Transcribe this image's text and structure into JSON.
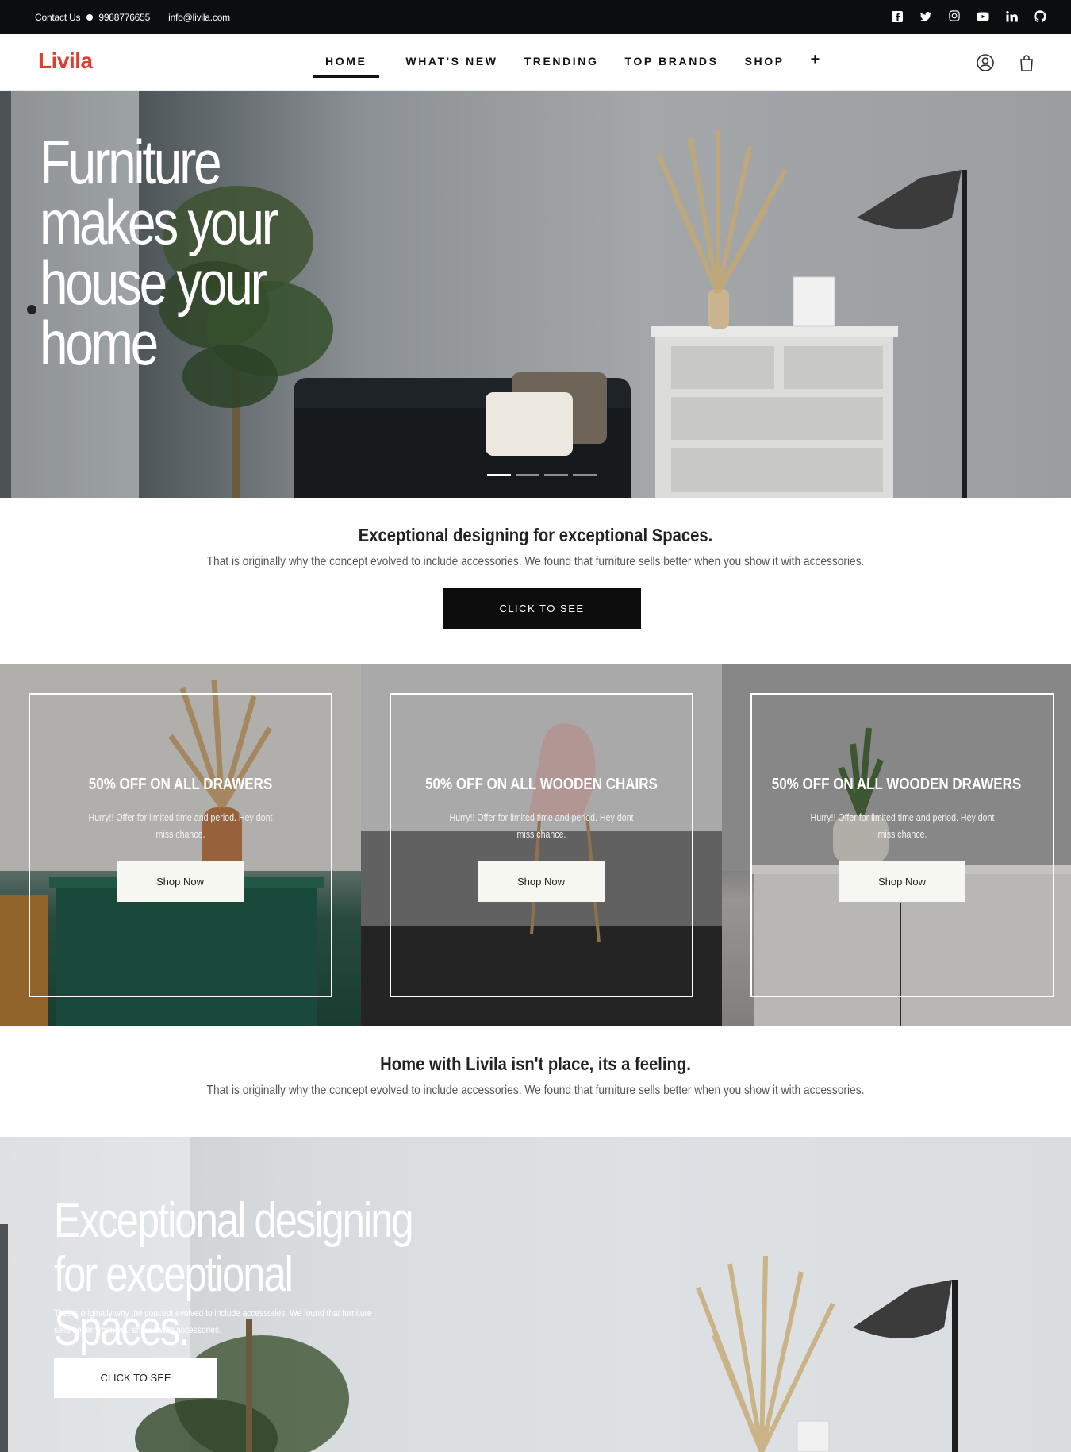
{
  "topbar": {
    "contact_label": "Contact Us",
    "phone": "9988776655",
    "email": "info@livila.com",
    "social": [
      "facebook-icon",
      "twitter-icon",
      "instagram-icon",
      "youtube-icon",
      "linkedin-icon",
      "github-icon"
    ]
  },
  "nav": {
    "logo": "Livila",
    "items": [
      "HOME",
      "WHAT'S NEW",
      "TRENDING",
      "TOP BRANDS",
      "SHOP"
    ],
    "more": "+",
    "icons": [
      "user-icon",
      "bag-icon"
    ]
  },
  "hero": {
    "title": "Furniture makes your house your home",
    "slides": 4,
    "active_slide": 1
  },
  "intro": {
    "title": "Exceptional designing for exceptional Spaces.",
    "text": "That is originally why the concept evolved to include accessories. We found that furniture sells better when you show it with accessories.",
    "button": "CLICK TO SEE"
  },
  "promos": [
    {
      "title": "50% OFF ON ALL DRAWERS",
      "text": "Hurry!! Offer for limited time and period. Hey dont miss chance.",
      "button": "Shop Now"
    },
    {
      "title": "50% OFF ON ALL WOODEN CHAIRS",
      "text": "Hurry!! Offer for limited time and period. Hey dont miss chance.",
      "button": "Shop Now"
    },
    {
      "title": "50% OFF ON ALL WOODEN DRAWERS",
      "text": "Hurry!! Offer for limited time and period. Hey dont miss chance.",
      "button": "Shop Now"
    }
  ],
  "feeling": {
    "title": "Home with Livila isn't place, its a feeling.",
    "text": "That is originally why the concept evolved to include accessories. We found that furniture sells better when you show it with accessories."
  },
  "hero2": {
    "title": "Exceptional designing for exceptional Spaces.",
    "text": "That is originally why the concept evolved to include accessories. We found that furniture sells better when you show it with accessories.",
    "button": "CLICK TO SEE"
  },
  "colors": {
    "brand": "#e03b2f",
    "dark": "#0c0d0e",
    "light_button": "#f7f7f2"
  }
}
